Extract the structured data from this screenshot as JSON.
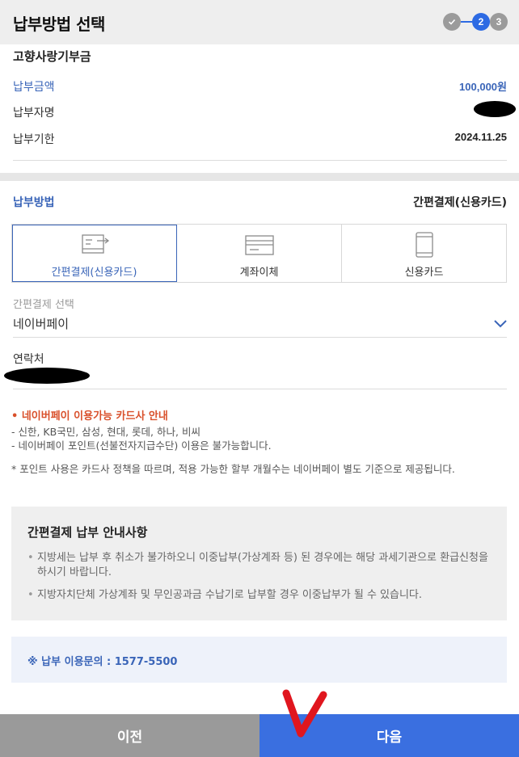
{
  "header": {
    "title": "납부방법 선택",
    "steps": [
      {
        "label": "✓",
        "state": "done"
      },
      {
        "label": "2",
        "state": "current"
      },
      {
        "label": "3",
        "state": "todo"
      }
    ]
  },
  "product": "고향사랑기부금",
  "info": {
    "amount_label": "납부금액",
    "amount_value": "100,000원",
    "payer_label": "납부자명",
    "deadline_label": "납부기한",
    "deadline_value": "2024.11.25"
  },
  "method": {
    "label": "납부방법",
    "value": "간편결제(신용카드)",
    "tabs": [
      {
        "label": "간편결제(신용카드)",
        "icon": "easy-pay-icon",
        "active": true
      },
      {
        "label": "계좌이체",
        "icon": "account-transfer-icon",
        "active": false
      },
      {
        "label": "신용카드",
        "icon": "credit-card-icon",
        "active": false
      }
    ]
  },
  "easy_pay": {
    "label": "간편결제 선택",
    "selected": "네이버페이"
  },
  "contact": {
    "label": "연락처"
  },
  "notice": {
    "title": "• 네이버페이 이용가능 카드사 안내",
    "line1": "- 신한, KB국민, 삼성, 현대, 롯데, 하나, 비씨",
    "line2": "- 네이버페이 포인트(선불전자지급수단) 이용은 불가능합니다.",
    "footnote": "* 포인트 사용은 카드사 정책을 따르며, 적용 가능한 할부 개월수는 네이버페이 별도 기준으로 제공됩니다."
  },
  "guide": {
    "title": "간편결제 납부 안내사항",
    "items": [
      "지방세는 납부 후 취소가 불가하오니 이중납부(가상계좌 등) 된 경우에는 해당 과세기관으로 환급신청을 하시기 바랍니다.",
      "지방자치단체 가상계좌 및 무인공과금 수납기로 납부할 경우 이중납부가 될 수 있습니다."
    ]
  },
  "inquiry": "※ 납부 이용문의 : 1577-5500",
  "buttons": {
    "prev": "이전",
    "next": "다음"
  },
  "colors": {
    "accent": "#3a65b8",
    "next_button": "#3a6fe0",
    "prev_button": "#9a9a9a",
    "notice_title": "#d9502b",
    "annotation": "#e0161e"
  }
}
